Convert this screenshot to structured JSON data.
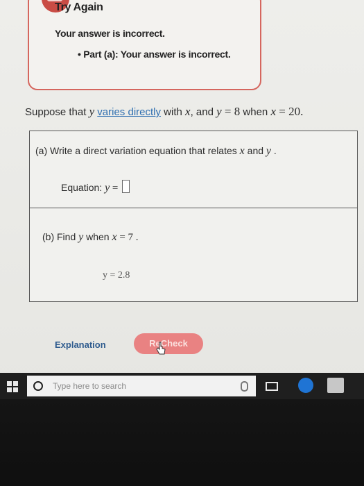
{
  "banner": {
    "title": "Try Again",
    "message": "Your answer is incorrect.",
    "part_bullet": "•",
    "part_message": "Part (a): Your answer is incorrect."
  },
  "problem": {
    "prefix": "Suppose that ",
    "var_y": "y",
    "link_text": "varies directly",
    "mid1": " with ",
    "var_x": "x",
    "mid2": ", and ",
    "var_y2": "y",
    "eq1": " = 8",
    "mid3": " when ",
    "var_x2": "x",
    "eq2": " = 20."
  },
  "part_a": {
    "prompt_text": "(a) Write a direct variation equation that relates ",
    "var_x": "x",
    "and": " and ",
    "var_y": "y",
    "end": " .",
    "equation_label": "Equation:  ",
    "equation_var": "y",
    "equals": " = "
  },
  "part_b": {
    "prompt_text": "(b) Find ",
    "var_y": "y",
    "when": "  when  ",
    "var_x": "x",
    "value": " = 7 .",
    "answer": "y = 2.8"
  },
  "actions": {
    "explanation_label": "Explanation",
    "recheck_label": "ReCheck"
  },
  "taskbar": {
    "search_placeholder": "Type here to search"
  },
  "colors": {
    "alert_red": "#c94c45",
    "link_blue": "#2f6fb0",
    "recheck_pink": "#e98282",
    "taskbar": "#1f1f1f"
  }
}
